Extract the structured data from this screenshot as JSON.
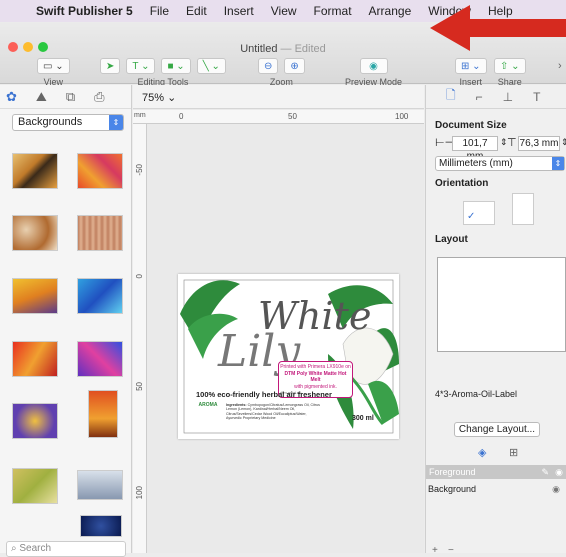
{
  "menubar": {
    "app_name": "Swift Publisher 5",
    "items": [
      "File",
      "Edit",
      "Insert",
      "View",
      "Format",
      "Arrange",
      "Window",
      "Help"
    ]
  },
  "window": {
    "title": "Untitled",
    "status": " — Edited"
  },
  "toolbar": {
    "view_label": "View",
    "editing_tools_label": "Editing Tools",
    "zoom_label": "Zoom",
    "preview_mode_label": "Preview Mode",
    "insert_label": "Insert",
    "share_label": "Share"
  },
  "left_panel": {
    "category": "Backgrounds",
    "search_placeholder": "Search"
  },
  "canvas": {
    "zoom": "75%",
    "ruler_h": [
      "0",
      "50",
      "100"
    ],
    "ruler_v": [
      "-50",
      "0",
      "50",
      "100"
    ],
    "ruler_unit": "mm"
  },
  "label": {
    "title_line1": "White",
    "title_line2": "Lily",
    "tagline": "100% eco-friendly herbal air freshener",
    "volume": "300 ml",
    "brand": "AROMA",
    "ingredients_label": "Ingredients:",
    "ingredients": "Cymbopogon/Citratus/Lemongrass Oil, Citrus Lemon (Lemon), Kardinal/Herbal/Neem Oil, Citrus/Seveliers/Cedar Wood Oil/Eucaliptus/Water, Ayurvedic Proprietary Medicine",
    "print_note_1": "Printed with Primera LX910e on",
    "print_note_2": "DTM Poly White Matte Hot Melt",
    "print_note_3": "with pigmented ink.",
    "print_url": "dtm-print.eu"
  },
  "inspector": {
    "doc_size_label": "Document Size",
    "width": "101,7 mm",
    "height": "76,3 mm",
    "units": "Millimeters (mm)",
    "orientation_label": "Orientation",
    "layout_label": "Layout",
    "layout_name": "4*3-Aroma-Oil-Label",
    "change_layout": "Change Layout...",
    "layer_foreground": "Foreground",
    "layer_background": "Background"
  },
  "colors": {
    "accent": "#3b73d1",
    "label_green": "#2e8b3c",
    "arrow_red": "#d62a1f"
  }
}
